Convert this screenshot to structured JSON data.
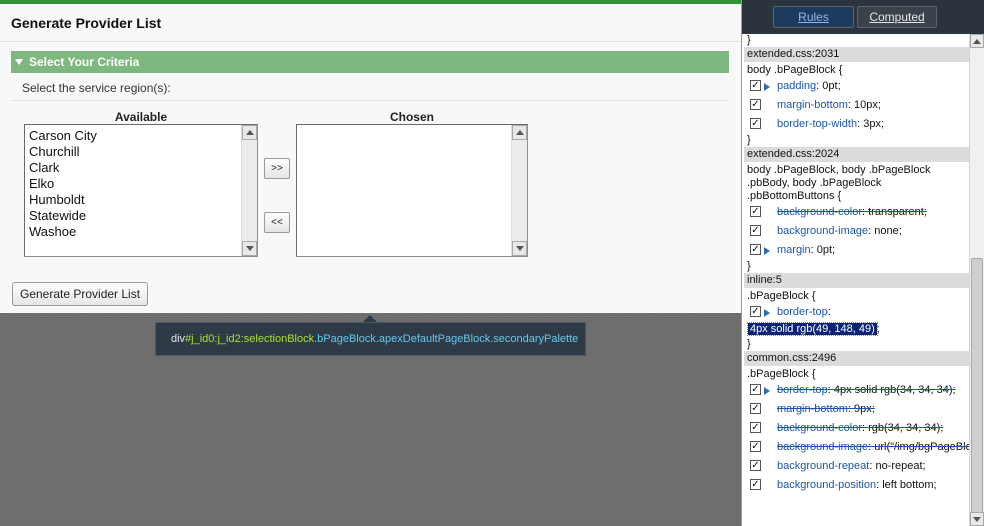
{
  "app": {
    "title": "Generate Provider List",
    "criteria_header": "Select Your Criteria",
    "region_label": "Select the service region(s):",
    "available_label": "Available",
    "chosen_label": "Chosen",
    "available_items": [
      "Carson City",
      "Churchill",
      "Clark",
      "Elko",
      "Humboldt",
      "Statewide",
      "Washoe"
    ],
    "chosen_items": [],
    "add_label": ">>",
    "remove_label": "<<",
    "generate_label": "Generate Provider List",
    "brand_color": "#319431",
    "header_color": "#7eb87e"
  },
  "tooltip": {
    "tag": "div",
    "id": "#j_id0:j_id2:selectionBlock",
    "classes": ".bPageBlock.apexDefaultPageBlock.secondaryPalette"
  },
  "devtools": {
    "tabs": {
      "rules": "Rules",
      "computed": "Computed"
    },
    "top_brace": "}",
    "rules": [
      {
        "source": "extended.css:2031",
        "selector": "body .bPageBlock {",
        "props": [
          {
            "twisty": true,
            "name": "padding",
            "value": "0pt;",
            "struck": false
          },
          {
            "twisty": false,
            "name": "margin-bottom",
            "value": "10px;",
            "struck": false
          },
          {
            "twisty": false,
            "name": "border-top-width",
            "value": "3px;",
            "struck": false
          }
        ],
        "close": "}"
      },
      {
        "source": "extended.css:2024",
        "selector": "body .bPageBlock, body .bPageBlock .pbBody, body .bPageBlock .pbBottomButtons {",
        "props": [
          {
            "twisty": false,
            "name": "background-color",
            "value": "transparent;",
            "struck": true
          },
          {
            "twisty": false,
            "name": "background-image",
            "value": "none;",
            "struck": false
          },
          {
            "twisty": true,
            "name": "margin",
            "value": "0pt;",
            "struck": false
          }
        ],
        "close": "}"
      },
      {
        "source": "inline:5",
        "selector": ".bPageBlock {",
        "props": [
          {
            "twisty": true,
            "name": "border-top",
            "value": "",
            "struck": false
          }
        ],
        "edit_value": "4px solid rgb(49, 148, 49)",
        "edit_suffix": ";",
        "close": "}"
      },
      {
        "source": "common.css:2496",
        "selector": ".bPageBlock {",
        "props": [
          {
            "twisty": true,
            "name": "border-top",
            "value": "4px solid rgb(34, 34, 34);",
            "struck": true
          },
          {
            "twisty": false,
            "name": "margin-bottom",
            "value": "9px;",
            "struck": true
          },
          {
            "twisty": false,
            "name": "background-color",
            "value": "rgb(34, 34, 34);",
            "struck": true
          },
          {
            "twisty": false,
            "name": "background-image",
            "value": "url(\"/img/bgPageBlockLeft.gif\");",
            "struck": true
          },
          {
            "twisty": false,
            "name": "background-repeat",
            "value": "no-repeat;",
            "struck": false
          },
          {
            "twisty": false,
            "name": "background-position",
            "value": "left bottom;",
            "struck": false
          }
        ],
        "close": ""
      }
    ]
  }
}
